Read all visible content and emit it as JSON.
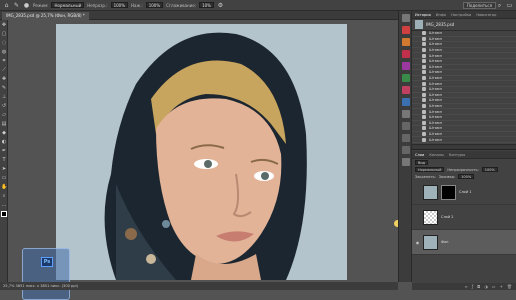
{
  "options_bar": {
    "mode_label": "Режим:",
    "mode_value": "Нормальный",
    "opacity_label": "Непрозр.:",
    "opacity_value": "100%",
    "flow_label": "Наж.:",
    "flow_value": "100%",
    "smooth_label": "Сглаживание:",
    "smooth_value": "10%",
    "share_label": "Поделиться"
  },
  "document_tab": "IMG_2835.psd @ 25,7% (Фон, RGB/8) *",
  "status_bar": "25,7%  3851 пикс. x 3851 пикс. (300 ppi)",
  "history_panel": {
    "tabs": [
      "История",
      "Инфо",
      "Настройки",
      "Навигатор"
    ],
    "snapshot_label": "IMG_2835.psd",
    "items": [
      "Штамп",
      "Штамп",
      "Штамп",
      "Штамп",
      "Штамп",
      "Штамп",
      "Штамп",
      "Штамп",
      "Штамп",
      "Штамп",
      "Штамп",
      "Штамп",
      "Штамп",
      "Штамп",
      "Штамп",
      "Штамп",
      "Штамп",
      "Штамп",
      "Штамп",
      "Штамп"
    ]
  },
  "layers_panel": {
    "tabs": [
      "Слои",
      "Каналы",
      "Контуры"
    ],
    "filter_label": "Вид",
    "blend_mode": "Нормальный",
    "opacity_label": "Непрозрачность:",
    "opacity_value": "100%",
    "lock_label": "Закрепить:",
    "fill_label": "Заливка:",
    "fill_value": "100%",
    "layers": [
      {
        "name": "Слой 1",
        "type": "masked"
      },
      {
        "name": "Слой 2",
        "type": "transparent"
      },
      {
        "name": "Фон",
        "type": "photo",
        "selected": true
      }
    ]
  },
  "colors": {
    "panel_bg": "#424242",
    "canvas_bg": "#535353",
    "selected_layer": "#5c5c5c"
  }
}
